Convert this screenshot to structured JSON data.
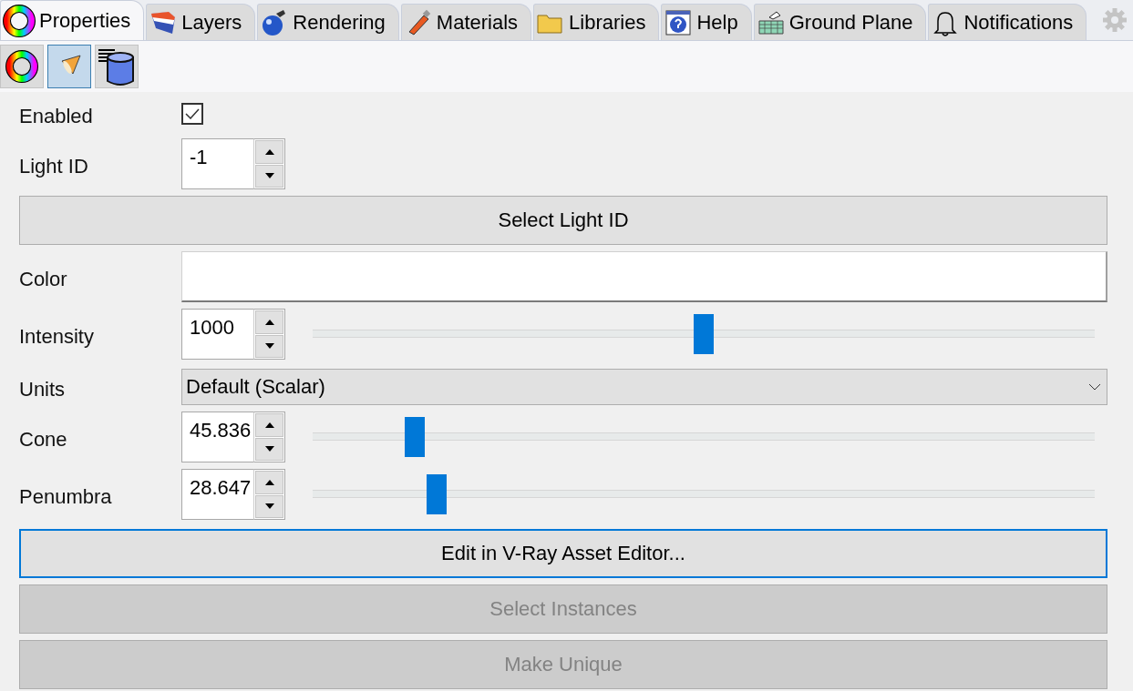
{
  "tabs": [
    {
      "label": "Properties",
      "selected": true
    },
    {
      "label": "Layers",
      "selected": false
    },
    {
      "label": "Rendering",
      "selected": false
    },
    {
      "label": "Materials",
      "selected": false
    },
    {
      "label": "Libraries",
      "selected": false
    },
    {
      "label": "Help",
      "selected": false
    },
    {
      "label": "Ground Plane",
      "selected": false
    },
    {
      "label": "Notifications",
      "selected": false
    }
  ],
  "subtoolbar": [
    {
      "selected": false
    },
    {
      "selected": true
    },
    {
      "selected": false
    }
  ],
  "rows": [
    {
      "kind": "checkbox",
      "label": "Enabled",
      "checked": true
    },
    {
      "kind": "spin",
      "label": "Light ID",
      "value": "-1"
    },
    {
      "kind": "button",
      "label": "Select Light ID",
      "disabled": false,
      "focused": false
    },
    {
      "kind": "color",
      "label": "Color"
    },
    {
      "kind": "slider",
      "label": "Intensity",
      "value": "1000",
      "level": 0.5
    },
    {
      "kind": "dropdown",
      "label": "Units",
      "value": "Default (Scalar)"
    },
    {
      "kind": "slider",
      "label": "Cone",
      "value": "45.836",
      "level": 0.13
    },
    {
      "kind": "slider",
      "label": "Penumbra",
      "value": "28.647",
      "level": 0.158
    },
    {
      "kind": "button",
      "label": "Edit in V-Ray Asset Editor...",
      "disabled": false,
      "focused": true
    },
    {
      "kind": "button",
      "label": "Select Instances",
      "disabled": true,
      "focused": false
    },
    {
      "kind": "button",
      "label": "Make Unique",
      "disabled": true,
      "focused": false
    }
  ]
}
